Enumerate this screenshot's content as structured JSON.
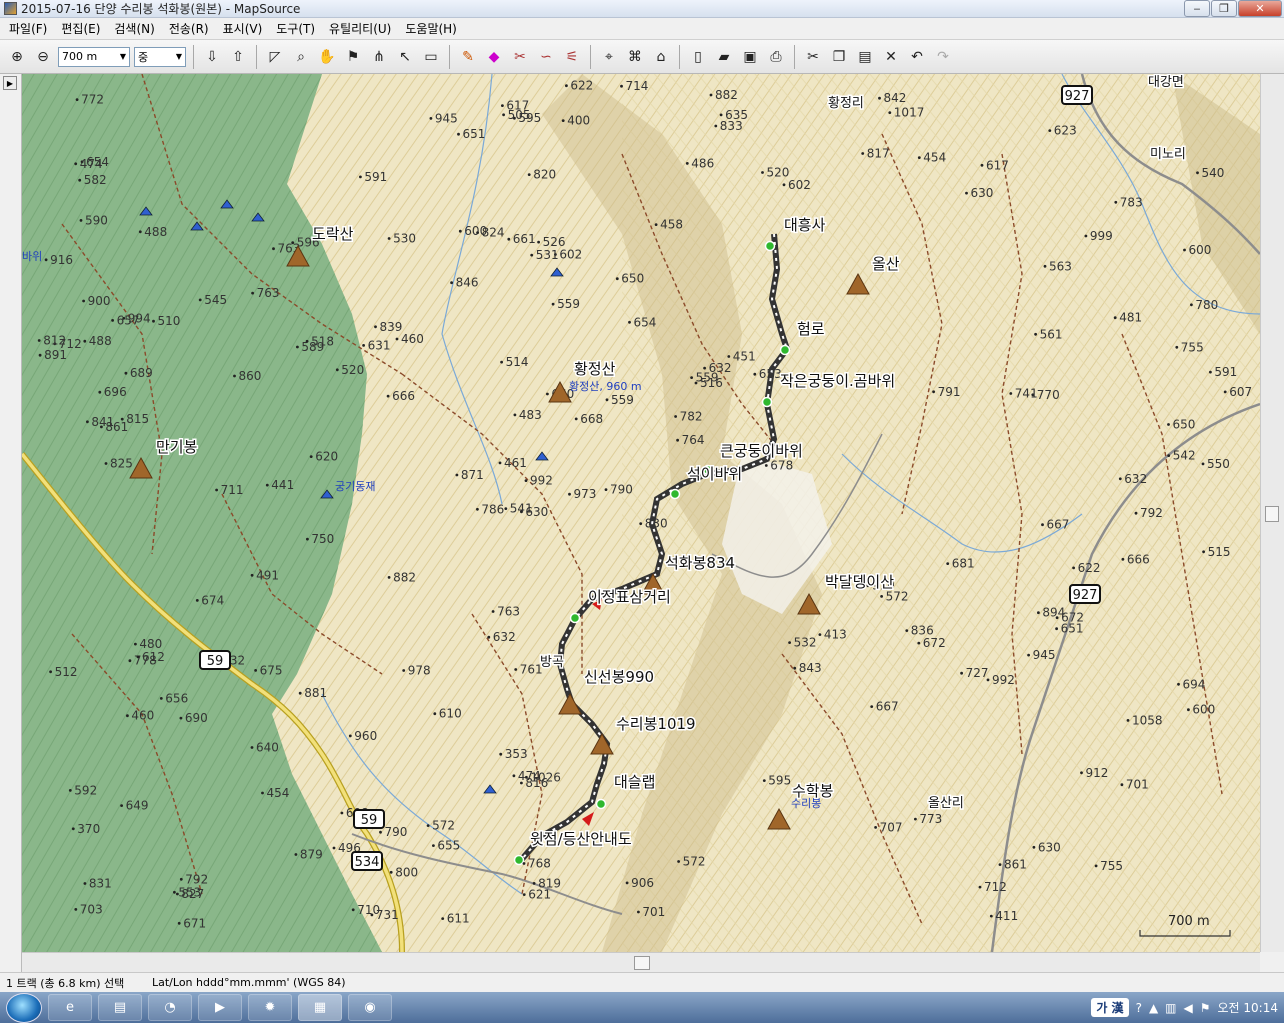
{
  "window": {
    "title": "2015-07-16 단양 수리봉 석화봉(원본) - MapSource",
    "minimize_glyph": "‒",
    "maximize_glyph": "❐",
    "close_glyph": "✕"
  },
  "menu": [
    "파일(F)",
    "편집(E)",
    "검색(N)",
    "전송(R)",
    "표시(V)",
    "도구(T)",
    "유틸리티(U)",
    "도움말(H)"
  ],
  "toolbar": {
    "zoom_level": "700 m",
    "detail_level": "중",
    "icons": [
      "zoom-in-icon",
      "zoom-out-icon",
      "receive-from-device-icon",
      "send-to-device-icon",
      "select-icon",
      "zoom-tool-icon",
      "hand-tool-icon",
      "waypoint-tool-icon",
      "route-tool-icon",
      "pointer-icon",
      "measure-icon",
      "track-draw-icon",
      "eraser-icon",
      "track-split-icon",
      "track-join-icon",
      "track-filter-icon",
      "find-icon",
      "find-nearby-icon",
      "find-address-icon",
      "new-icon",
      "open-icon",
      "save-icon",
      "print-icon",
      "cut-icon",
      "copy-icon",
      "paste-icon",
      "delete-icon",
      "undo-icon",
      "redo-icon"
    ]
  },
  "map": {
    "colors": {
      "track": "#555555",
      "forest": "#7fae7f",
      "terrain": "#efe6c4",
      "road": "#e8d45a",
      "water": "#7aa9d8",
      "peak": "#8a5a22"
    },
    "labels": [
      {
        "text": "도락산",
        "kind": "peak"
      },
      {
        "text": "황정산",
        "kind": "peak"
      },
      {
        "text": "황정산, 960 m",
        "kind": "blue"
      },
      {
        "text": "만기봉",
        "kind": "peak"
      },
      {
        "text": "올산",
        "kind": "peak"
      },
      {
        "text": "대흥사",
        "kind": "waypoint"
      },
      {
        "text": "험로",
        "kind": "waypoint"
      },
      {
        "text": "작은궁둥이.곰바위",
        "kind": "waypoint"
      },
      {
        "text": "큰궁둥이바위",
        "kind": "waypoint"
      },
      {
        "text": "석이바위",
        "kind": "waypoint"
      },
      {
        "text": "석화봉834",
        "kind": "waypoint"
      },
      {
        "text": "박달뎅이산",
        "kind": "peak"
      },
      {
        "text": "이정표삼거리",
        "kind": "waypoint"
      },
      {
        "text": "신선봉990",
        "kind": "waypoint"
      },
      {
        "text": "수리봉1019",
        "kind": "waypoint"
      },
      {
        "text": "대슬랩",
        "kind": "waypoint"
      },
      {
        "text": "수학봉",
        "kind": "peak"
      },
      {
        "text": "윗점/등산안내도",
        "kind": "waypoint"
      },
      {
        "text": "궁기동재",
        "kind": "blue"
      },
      {
        "text": "대강면",
        "kind": "area"
      },
      {
        "text": "황정리",
        "kind": "area"
      },
      {
        "text": "미노리",
        "kind": "area"
      },
      {
        "text": "올산리",
        "kind": "area"
      },
      {
        "text": "방곡",
        "kind": "area"
      },
      {
        "text": "바위",
        "kind": "blue"
      },
      {
        "text": "수리봉",
        "kind": "blue"
      }
    ],
    "roads": [
      "927",
      "927",
      "59",
      "59",
      "534"
    ],
    "elevations": [
      "755",
      "815",
      "783",
      "786",
      "792",
      "661",
      "654",
      "656",
      "460",
      "370",
      "454",
      "526",
      "516",
      "572",
      "488",
      "595",
      "607",
      "481",
      "461",
      "353",
      "483",
      "596",
      "817",
      "881",
      "861",
      "912",
      "910",
      "701",
      "631",
      "860",
      "843",
      "879",
      "755",
      "782",
      "831",
      "816",
      "764",
      "460",
      "563",
      "540",
      "413",
      "595",
      "640",
      "671",
      "703",
      "617",
      "622",
      "620",
      "712",
      "763",
      "454",
      "553",
      "635",
      "651",
      "660",
      "694",
      "761",
      "790",
      "589",
      "592",
      "772",
      "545",
      "515",
      "514",
      "559",
      "649",
      "678",
      "672",
      "768",
      "770",
      "773",
      "906",
      "617",
      "792",
      "653",
      "667",
      "668",
      "945",
      "891",
      "819",
      "520",
      "602",
      "711",
      "710",
      "632",
      "591",
      "674",
      "675",
      "608",
      "559",
      "630",
      "666",
      "667",
      "582",
      "602",
      "871",
      "731",
      "512",
      "630",
      "623",
      "600",
      "611",
      "778",
      "411",
      "650",
      "530",
      "491",
      "630",
      "655",
      "791",
      "590",
      "612",
      "572",
      "518",
      "591",
      "622",
      "672",
      "750",
      "480",
      "666",
      "839",
      "830",
      "689",
      "727",
      "790",
      "632",
      "654",
      "572",
      "707",
      "474",
      "505",
      "561",
      "763",
      "812",
      "800",
      "681",
      "714",
      "820",
      "559",
      "441",
      "458",
      "400",
      "542",
      "621",
      "833",
      "900",
      "763",
      "701",
      "827",
      "712",
      "992",
      "780",
      "882",
      "451",
      "496",
      "486",
      "532",
      "600",
      "994",
      "916",
      "973",
      "488",
      "474",
      "510",
      "657",
      "696",
      "960",
      "992",
      "894",
      "978",
      "531",
      "1026",
      "825",
      "824",
      "836",
      "832",
      "861",
      "842",
      "846",
      "650",
      "550",
      "541",
      "600",
      "632",
      "1017",
      "1058",
      "999",
      "520",
      "651",
      "741",
      "610",
      "690",
      "882",
      "841",
      "945"
    ],
    "scale_label": "700 m"
  },
  "statusbar": {
    "selection": "1 트랙 (총 6.8 km) 선택",
    "coord_format": "Lat/Lon hddd°mm.mmm' (WGS 84)"
  },
  "taskbar": {
    "apps": [
      "ie-icon",
      "explorer-icon",
      "app-icon",
      "media-icon",
      "settings-icon",
      "mapsource-icon",
      "viewer-icon"
    ],
    "lang_indicator": "가 漢",
    "clock": "오전 10:14"
  }
}
